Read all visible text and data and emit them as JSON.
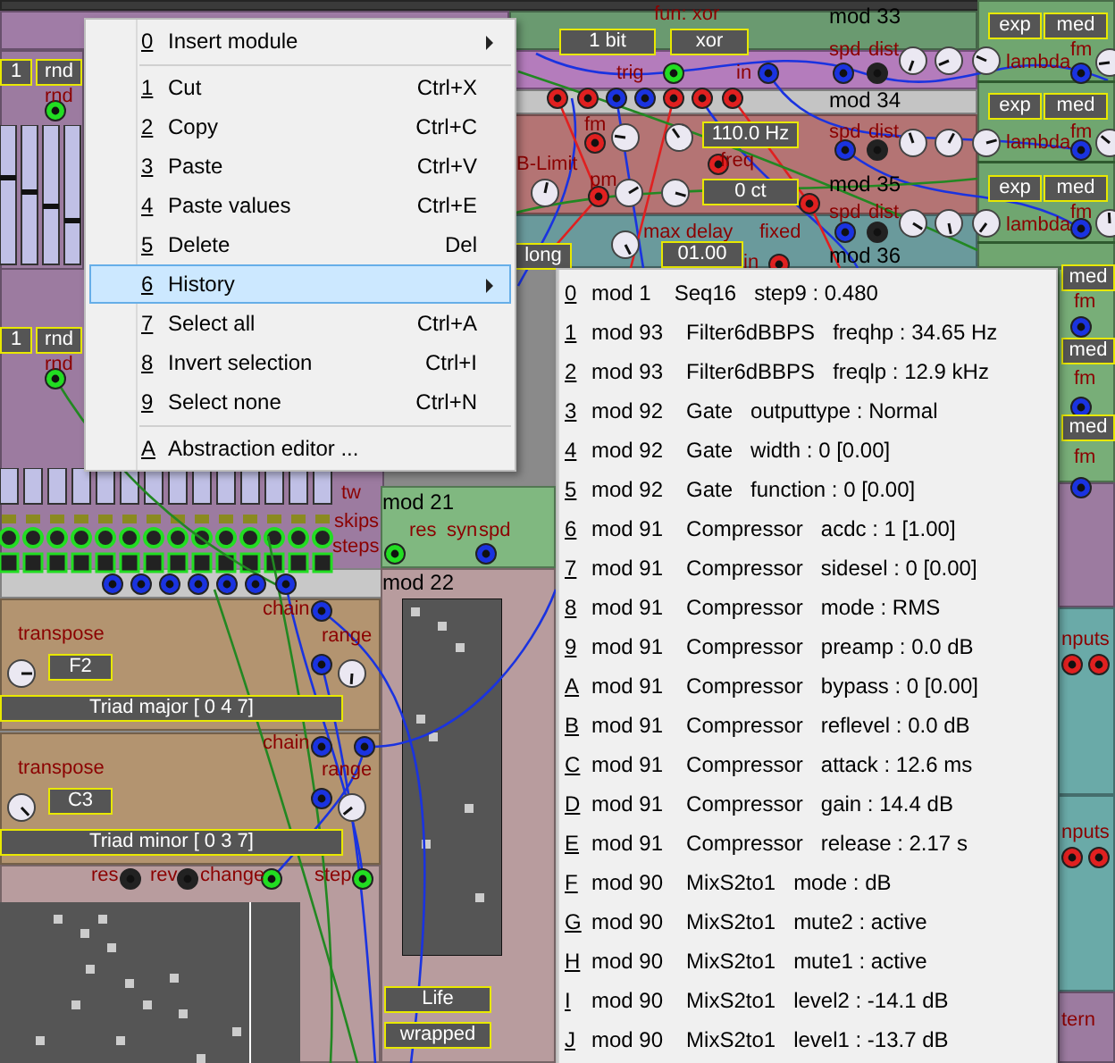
{
  "patch": {
    "texts": [
      {
        "text": "fun: xor",
        "kind": "label"
      },
      {
        "text": "1 bit",
        "kind": "display"
      },
      {
        "text": "xor",
        "kind": "display"
      },
      {
        "text": "mod 33",
        "kind": "title"
      },
      {
        "text": "exp",
        "kind": "display"
      },
      {
        "text": "med",
        "kind": "display"
      },
      {
        "text": "trig",
        "kind": "label"
      },
      {
        "text": "in",
        "kind": "label"
      },
      {
        "text": "spd",
        "kind": "label"
      },
      {
        "text": "dist",
        "kind": "label"
      },
      {
        "text": "lambda",
        "kind": "label"
      },
      {
        "text": "fm",
        "kind": "label"
      },
      {
        "text": "1",
        "kind": "display"
      },
      {
        "text": "rnd",
        "kind": "display"
      },
      {
        "text": "rnd",
        "kind": "label"
      },
      {
        "text": "110.0 Hz",
        "kind": "display"
      },
      {
        "text": "fm",
        "kind": "label"
      },
      {
        "text": "B-Limit",
        "kind": "label"
      },
      {
        "text": "pm",
        "kind": "label"
      },
      {
        "text": "freq",
        "kind": "label"
      },
      {
        "text": "0 ct",
        "kind": "display"
      },
      {
        "text": "mod 34",
        "kind": "title"
      },
      {
        "text": "exp",
        "kind": "display"
      },
      {
        "text": "med",
        "kind": "display"
      },
      {
        "text": "spd",
        "kind": "label"
      },
      {
        "text": "dist",
        "kind": "label"
      },
      {
        "text": "lambda",
        "kind": "label"
      },
      {
        "text": "fm",
        "kind": "label"
      },
      {
        "text": "mod 35",
        "kind": "title"
      },
      {
        "text": "exp",
        "kind": "display"
      },
      {
        "text": "med",
        "kind": "display"
      },
      {
        "text": "spd",
        "kind": "label"
      },
      {
        "text": "dist",
        "kind": "label"
      },
      {
        "text": "lambda",
        "kind": "label"
      },
      {
        "text": "fm",
        "kind": "label"
      },
      {
        "text": "max delay",
        "kind": "label"
      },
      {
        "text": "fixed",
        "kind": "label"
      },
      {
        "text": "long",
        "kind": "display"
      },
      {
        "text": "01.00",
        "kind": "display"
      },
      {
        "text": "in",
        "kind": "label"
      },
      {
        "text": "mod 36",
        "kind": "title"
      },
      {
        "text": "1",
        "kind": "display"
      },
      {
        "text": "rnd",
        "kind": "display"
      },
      {
        "text": "rnd",
        "kind": "label"
      },
      {
        "text": "tw",
        "kind": "label"
      },
      {
        "text": "skips",
        "kind": "label"
      },
      {
        "text": "steps",
        "kind": "label"
      },
      {
        "text": "mod 21",
        "kind": "title"
      },
      {
        "text": "res",
        "kind": "label"
      },
      {
        "text": "syn",
        "kind": "label"
      },
      {
        "text": "spd",
        "kind": "label"
      },
      {
        "text": "mod 22",
        "kind": "title"
      },
      {
        "text": "chain",
        "kind": "label"
      },
      {
        "text": "range",
        "kind": "label"
      },
      {
        "text": "transpose",
        "kind": "label"
      },
      {
        "text": "F2",
        "kind": "display"
      },
      {
        "text": "Triad major [ 0 4 7]",
        "kind": "display"
      },
      {
        "text": "chain",
        "kind": "label"
      },
      {
        "text": "range",
        "kind": "label"
      },
      {
        "text": "transpose",
        "kind": "label"
      },
      {
        "text": "C3",
        "kind": "display"
      },
      {
        "text": "Triad minor [ 0 3 7]",
        "kind": "display"
      },
      {
        "text": "res",
        "kind": "label"
      },
      {
        "text": "rev",
        "kind": "label"
      },
      {
        "text": "change",
        "kind": "label"
      },
      {
        "text": "step",
        "kind": "label"
      },
      {
        "text": "Life",
        "kind": "display"
      },
      {
        "text": "wrapped",
        "kind": "display"
      },
      {
        "text": "med",
        "kind": "display"
      },
      {
        "text": "fm",
        "kind": "label"
      },
      {
        "text": "med",
        "kind": "display"
      },
      {
        "text": "fm",
        "kind": "label"
      },
      {
        "text": "med",
        "kind": "display"
      },
      {
        "text": "fm",
        "kind": "label"
      },
      {
        "text": "nputs",
        "kind": "label"
      },
      {
        "text": "nputs",
        "kind": "label"
      },
      {
        "text": "tern",
        "kind": "label"
      }
    ]
  },
  "context_menu": {
    "groups": [
      {
        "items": [
          {
            "key": "0",
            "label": "Insert module",
            "submenu": true,
            "selected": false
          }
        ]
      },
      {
        "items": [
          {
            "key": "1",
            "label": "Cut",
            "shortcut": "Ctrl+X",
            "submenu": false,
            "selected": false
          },
          {
            "key": "2",
            "label": "Copy",
            "shortcut": "Ctrl+C",
            "submenu": false,
            "selected": false
          },
          {
            "key": "3",
            "label": "Paste",
            "shortcut": "Ctrl+V",
            "submenu": false,
            "selected": false
          },
          {
            "key": "4",
            "label": "Paste values",
            "shortcut": "Ctrl+E",
            "submenu": false,
            "selected": false
          },
          {
            "key": "5",
            "label": "Delete",
            "shortcut": "Del",
            "submenu": false,
            "selected": false
          },
          {
            "key": "6",
            "label": "History",
            "submenu": true,
            "selected": true
          },
          {
            "key": "7",
            "label": "Select all",
            "shortcut": "Ctrl+A",
            "submenu": false,
            "selected": false
          },
          {
            "key": "8",
            "label": "Invert selection",
            "shortcut": "Ctrl+I",
            "submenu": false,
            "selected": false
          },
          {
            "key": "9",
            "label": "Select none",
            "shortcut": "Ctrl+N",
            "submenu": false,
            "selected": false
          }
        ]
      },
      {
        "items": [
          {
            "key": "A",
            "label": "Abstraction editor ...",
            "submenu": false,
            "selected": false
          }
        ]
      }
    ]
  },
  "history_menu": {
    "items": [
      {
        "key": "0",
        "module": "mod 1",
        "type": "Seq16",
        "change": "step9 : 0.480"
      },
      {
        "key": "1",
        "module": "mod 93",
        "type": "Filter6dBBPS",
        "change": "freqhp : 34.65 Hz"
      },
      {
        "key": "2",
        "module": "mod 93",
        "type": "Filter6dBBPS",
        "change": "freqlp : 12.9 kHz"
      },
      {
        "key": "3",
        "module": "mod 92",
        "type": "Gate",
        "change": "outputtype : Normal"
      },
      {
        "key": "4",
        "module": "mod 92",
        "type": "Gate",
        "change": "width :  0 [0.00]"
      },
      {
        "key": "5",
        "module": "mod 92",
        "type": "Gate",
        "change": "function :  0 [0.00]"
      },
      {
        "key": "6",
        "module": "mod 91",
        "type": "Compressor",
        "change": "acdc :  1 [1.00]"
      },
      {
        "key": "7",
        "module": "mod 91",
        "type": "Compressor",
        "change": "sidesel :  0 [0.00]"
      },
      {
        "key": "8",
        "module": "mod 91",
        "type": "Compressor",
        "change": "mode : RMS"
      },
      {
        "key": "9",
        "module": "mod 91",
        "type": "Compressor",
        "change": "preamp : 0.0 dB"
      },
      {
        "key": "A",
        "module": "mod 91",
        "type": "Compressor",
        "change": "bypass :  0 [0.00]"
      },
      {
        "key": "B",
        "module": "mod 91",
        "type": "Compressor",
        "change": "reflevel : 0.0 dB"
      },
      {
        "key": "C",
        "module": "mod 91",
        "type": "Compressor",
        "change": "attack : 12.6 ms"
      },
      {
        "key": "D",
        "module": "mod 91",
        "type": "Compressor",
        "change": "gain : 14.4 dB"
      },
      {
        "key": "E",
        "module": "mod 91",
        "type": "Compressor",
        "change": "release : 2.17 s"
      },
      {
        "key": "F",
        "module": "mod 90",
        "type": "MixS2to1",
        "change": "mode : dB"
      },
      {
        "key": "G",
        "module": "mod 90",
        "type": "MixS2to1",
        "change": "mute2 : active"
      },
      {
        "key": "H",
        "module": "mod 90",
        "type": "MixS2to1",
        "change": "mute1 : active"
      },
      {
        "key": "I",
        "module": "mod 90",
        "type": "MixS2to1",
        "change": "level2 : -14.1 dB"
      },
      {
        "key": "J",
        "module": "mod 90",
        "type": "MixS2to1",
        "change": "level1 : -13.7 dB"
      }
    ]
  }
}
